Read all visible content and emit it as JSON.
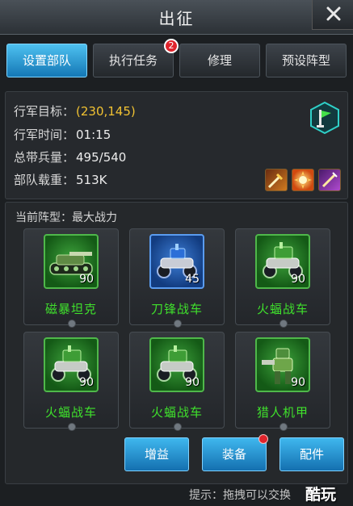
{
  "window": {
    "title": "出征"
  },
  "tabs": [
    {
      "label": "设置部队",
      "active": true
    },
    {
      "label": "执行任务",
      "badge": "2"
    },
    {
      "label": "修理"
    },
    {
      "label": "预设阵型"
    }
  ],
  "march": {
    "target_label": "行军目标：",
    "target_value": "(230,145)",
    "time_label": "行军时间：",
    "time_value": "01:15",
    "troops_label": "总带兵量：",
    "troops_value": "495/540",
    "load_label": "部队载重：",
    "load_value": "513K",
    "flag_icon": "green-flag-icon",
    "buff_icons": [
      "sword-buff-icon",
      "fire-buff-icon",
      "speed-buff-icon"
    ]
  },
  "formation": {
    "label": "当前阵型：最大战力",
    "units": [
      {
        "name": "磁暴坦克",
        "level": "90",
        "color": "green",
        "icon": "tank-icon"
      },
      {
        "name": "刀锋战车",
        "level": "45",
        "color": "blue",
        "icon": "chariot-icon"
      },
      {
        "name": "火蝠战车",
        "level": "90",
        "color": "green",
        "icon": "chariot-icon"
      },
      {
        "name": "火蝠战车",
        "level": "90",
        "color": "green",
        "icon": "chariot-icon"
      },
      {
        "name": "火蝠战车",
        "level": "90",
        "color": "green",
        "icon": "chariot-icon"
      },
      {
        "name": "猎人机甲",
        "level": "90",
        "color": "green",
        "icon": "mech-icon"
      }
    ]
  },
  "buttons": {
    "gain_label": "增益",
    "equip_label": "装备",
    "parts_label": "配件"
  },
  "footer": {
    "hint": "提示：拖拽可以交换",
    "watermark": "酷玩"
  },
  "colors": {
    "accent": "#1f8fd0",
    "unit_name": "#3fe02c",
    "target_value": "#f1c232",
    "badge": "#e0242c"
  }
}
